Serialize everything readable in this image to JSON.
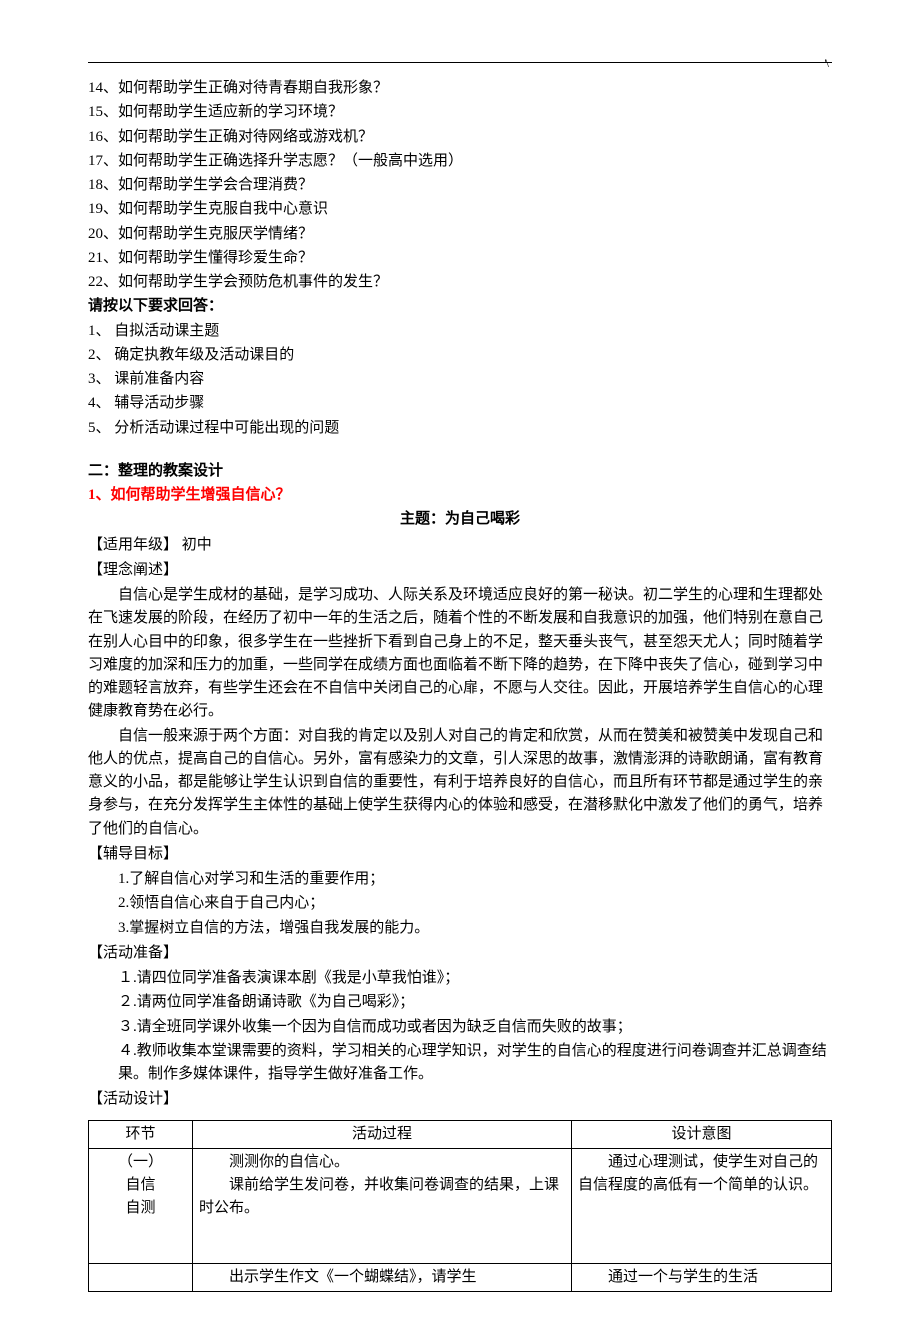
{
  "cornerMark": "'\\",
  "questions": {
    "q14": "14、如何帮助学生正确对待青春期自我形象？",
    "q15": "15、如何帮助学生适应新的学习环境？",
    "q16": "16、如何帮助学生正确对待网络或游戏机？",
    "q17": "17、如何帮助学生正确选择升学志愿？（一般高中选用）",
    "q18": "18、如何帮助学生学会合理消费？",
    "q19": "19、如何帮助学生克服自我中心意识",
    "q20": "20、如何帮助学生克服厌学情绪？",
    "q21": "21、如何帮助学生懂得珍爱生命？",
    "q22": "22、如何帮助学生学会预防危机事件的发生？"
  },
  "reqTitle": "请按以下要求回答：",
  "requirements": {
    "r1": "1、 自拟活动课主题",
    "r2": "2、 确定执教年级及活动课目的",
    "r3": "3、 课前准备内容",
    "r4": "4、 辅导活动步骤",
    "r5": "5、 分析活动课过程中可能出现的问题"
  },
  "sectionTwo": "二：整理的教案设计",
  "item1Title": "1、如何帮助学生增强自信心？",
  "subjectLine": "主题：为自己喝彩",
  "gradeLabel": "【适用年级】  初中",
  "ideaLabel": "【理念阐述】",
  "ideaP1": "自信心是学生成材的基础，是学习成功、人际关系及环境适应良好的第一秘诀。初二学生的心理和生理都处在飞速发展的阶段，在经历了初中一年的生活之后，随着个性的不断发展和自我意识的加强，他们特别在意自己在别人心目中的印象，很多学生在一些挫折下看到自己身上的不足，整天垂头丧气，甚至怨天尤人；同时随着学习难度的加深和压力的加重，一些同学在成绩方面也面临着不断下降的趋势，在下降中丧失了信心，碰到学习中的难题轻言放弃，有些学生还会在不自信中关闭自己的心扉，不愿与人交往。因此，开展培养学生自信心的心理健康教育势在必行。",
  "ideaP2": "自信一般来源于两个方面：对自我的肯定以及别人对自己的肯定和欣赏，从而在赞美和被赞美中发现自己和他人的优点，提高自己的自信心。另外，富有感染力的文章，引人深思的故事，激情澎湃的诗歌朗诵，富有教育意义的小品，都是能够让学生认识到自信的重要性，有利于培养良好的自信心，而且所有环节都是通过学生的亲身参与，在充分发挥学生主体性的基础上使学生获得内心的体验和感受，在潜移默化中激发了他们的勇气，培养了他们的自信心。",
  "goalLabel": "【辅导目标】",
  "goals": {
    "g1": "1.了解自信心对学习和生活的重要作用；",
    "g2": "2.领悟自信心来自于自己内心；",
    "g3": "3.掌握树立自信的方法，增强自我发展的能力。"
  },
  "prepLabel": "【活动准备】",
  "preps": {
    "p1": "１.请四位同学准备表演课本剧《我是小草我怕谁》；",
    "p2": "２.请两位同学准备朗诵诗歌《为自己喝彩》；",
    "p3": "３.请全班同学课外收集一个因为自信而成功或者因为缺乏自信而失败的故事；",
    "p4": "４.教师收集本堂课需要的资料，学习相关的心理学知识，对学生的自信心的程度进行问卷调查并汇总调查结果。制作多媒体课件，指导学生做好准备工作。"
  },
  "designLabel": "【活动设计】",
  "table": {
    "header": {
      "h1": "环节",
      "h2": "活动过程",
      "h3": "设计意图"
    },
    "row1": {
      "c1a": "（一）",
      "c1b": "自信",
      "c1c": "自测",
      "c2a": "测测你的自信心。",
      "c2b": "课前给学生发问卷，并收集问卷调查的结果，上课时公布。",
      "c3": "通过心理测试，使学生对自己的自信程度的高低有一个简单的认识。"
    },
    "row2": {
      "c2": "出示学生作文《一个蝴蝶结》，请学生",
      "c3": "通过一个与学生的生活"
    }
  }
}
